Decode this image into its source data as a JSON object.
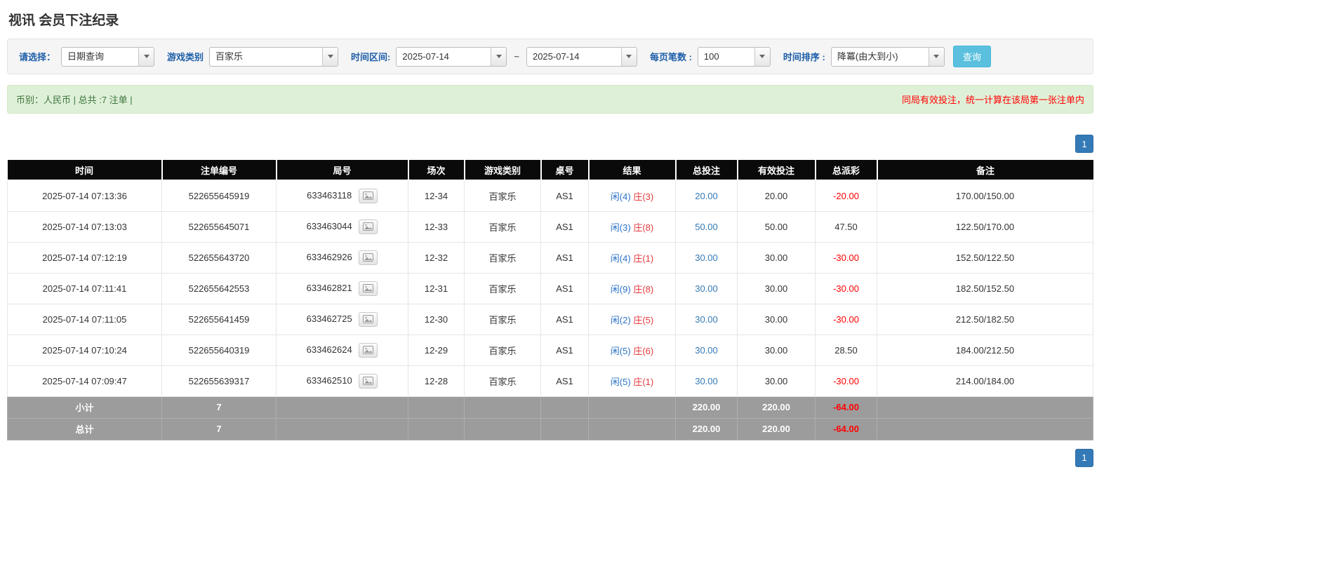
{
  "page": {
    "title": "视讯 会员下注纪录"
  },
  "filters": {
    "select_label": "请选择：",
    "select_value": "日期查询",
    "game_label": "游戏类别",
    "game_value": "百家乐",
    "range_label": "时间区间:",
    "range_from": "2025-07-14",
    "range_sep": "~",
    "range_to": "2025-07-14",
    "perpage_label": "每页笔数 :",
    "perpage_value": "100",
    "sort_label": "时间排序 :",
    "sort_value": "降冪(由大到小)",
    "search_button": "查询"
  },
  "summary": {
    "left": "币别：人民币 | 总共 :7 注单 |",
    "right": "同局有效投注，统一计算在该局第一张注单内"
  },
  "pagination": {
    "page": "1"
  },
  "table": {
    "headers": [
      "时间",
      "注单编号",
      "局号",
      "场次",
      "游戏类别",
      "桌号",
      "结果",
      "总投注",
      "有效投注",
      "总派彩",
      "备注"
    ],
    "rows": [
      {
        "time": "2025-07-14 07:13:36",
        "bet_id": "522655645919",
        "round_id": "633463118",
        "session": "12-34",
        "game": "百家乐",
        "table_no": "AS1",
        "result_player": "闲(4)",
        "result_banker": "庄(3)",
        "total_bet": "20.00",
        "valid_bet": "20.00",
        "payout": "-20.00",
        "remark": "170.00/150.00"
      },
      {
        "time": "2025-07-14 07:13:03",
        "bet_id": "522655645071",
        "round_id": "633463044",
        "session": "12-33",
        "game": "百家乐",
        "table_no": "AS1",
        "result_player": "闲(3)",
        "result_banker": "庄(8)",
        "total_bet": "50.00",
        "valid_bet": "50.00",
        "payout": "47.50",
        "remark": "122.50/170.00"
      },
      {
        "time": "2025-07-14 07:12:19",
        "bet_id": "522655643720",
        "round_id": "633462926",
        "session": "12-32",
        "game": "百家乐",
        "table_no": "AS1",
        "result_player": "闲(4)",
        "result_banker": "庄(1)",
        "total_bet": "30.00",
        "valid_bet": "30.00",
        "payout": "-30.00",
        "remark": "152.50/122.50"
      },
      {
        "time": "2025-07-14 07:11:41",
        "bet_id": "522655642553",
        "round_id": "633462821",
        "session": "12-31",
        "game": "百家乐",
        "table_no": "AS1",
        "result_player": "闲(9)",
        "result_banker": "庄(8)",
        "total_bet": "30.00",
        "valid_bet": "30.00",
        "payout": "-30.00",
        "remark": "182.50/152.50"
      },
      {
        "time": "2025-07-14 07:11:05",
        "bet_id": "522655641459",
        "round_id": "633462725",
        "session": "12-30",
        "game": "百家乐",
        "table_no": "AS1",
        "result_player": "闲(2)",
        "result_banker": "庄(5)",
        "total_bet": "30.00",
        "valid_bet": "30.00",
        "payout": "-30.00",
        "remark": "212.50/182.50"
      },
      {
        "time": "2025-07-14 07:10:24",
        "bet_id": "522655640319",
        "round_id": "633462624",
        "session": "12-29",
        "game": "百家乐",
        "table_no": "AS1",
        "result_player": "闲(5)",
        "result_banker": "庄(6)",
        "total_bet": "30.00",
        "valid_bet": "30.00",
        "payout": "28.50",
        "remark": "184.00/212.50"
      },
      {
        "time": "2025-07-14 07:09:47",
        "bet_id": "522655639317",
        "round_id": "633462510",
        "session": "12-28",
        "game": "百家乐",
        "table_no": "AS1",
        "result_player": "闲(5)",
        "result_banker": "庄(1)",
        "total_bet": "30.00",
        "valid_bet": "30.00",
        "payout": "-30.00",
        "remark": "214.00/184.00"
      }
    ],
    "subtotal": {
      "label": "小计",
      "count": "7",
      "total_bet": "220.00",
      "valid_bet": "220.00",
      "payout": "-64.00"
    },
    "total": {
      "label": "总计",
      "count": "7",
      "total_bet": "220.00",
      "valid_bet": "220.00",
      "payout": "-64.00"
    }
  }
}
